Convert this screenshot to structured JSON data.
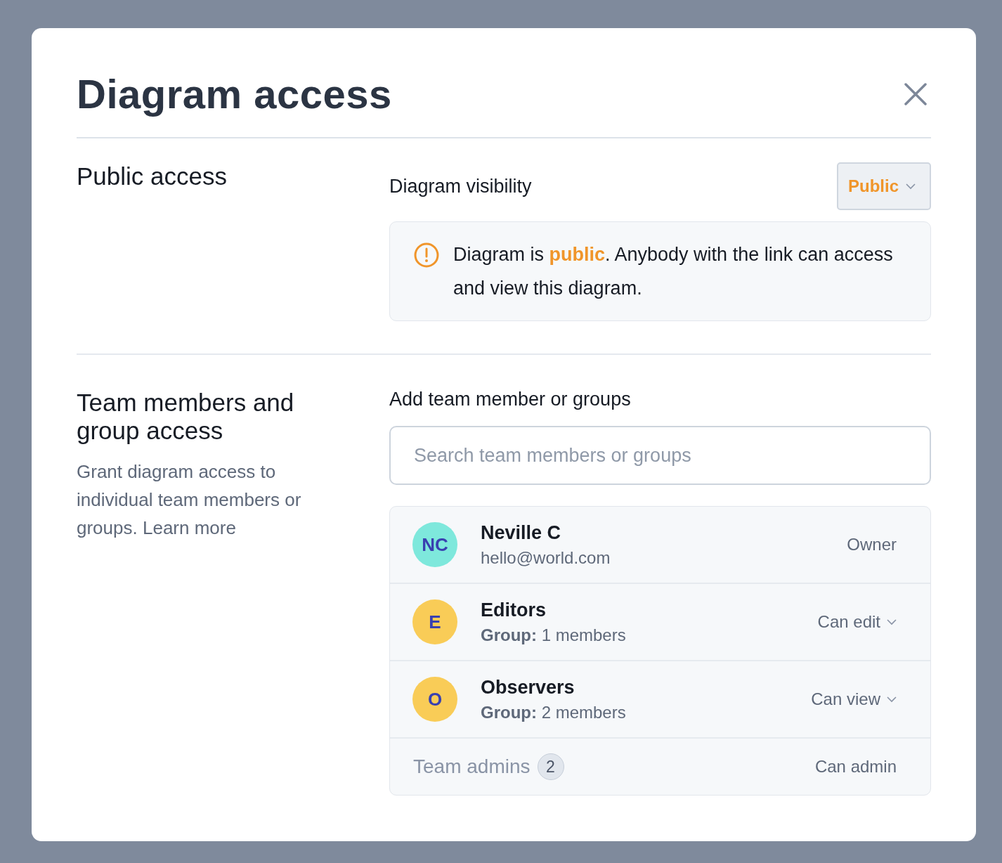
{
  "dialog": {
    "title": "Diagram access"
  },
  "public_access": {
    "heading": "Public access",
    "visibility_label": "Diagram visibility",
    "visibility_value": "Public",
    "notice": "Diagram is **public**. Anybody with the link can access and view this diagram."
  },
  "team_access": {
    "heading": "Team members and group access",
    "description": "Grant diagram access to individual team members or groups.",
    "link": "Learn more",
    "add_label": "Add team member or groups",
    "search": {
      "placeholder": "Search team members or groups"
    },
    "members": [
      {
        "kind": "member",
        "initials": "NC",
        "color": "#7ee8dc",
        "name": "Neville C",
        "detail": "hello@world.com",
        "role": "Owner"
      },
      {
        "kind": "group",
        "initials": "E",
        "color": "#f9cc57",
        "name": "Editors",
        "detail": "**Group:** 1 members",
        "role": "Can edit"
      },
      {
        "kind": "group",
        "initials": "O",
        "color": "#f9cc57",
        "name": "Observers",
        "detail": "**Group:** 2 members",
        "role": "Can view"
      },
      {
        "kind": "admins",
        "name": "Team admins",
        "count": "2",
        "role": "Can admin"
      }
    ]
  }
}
